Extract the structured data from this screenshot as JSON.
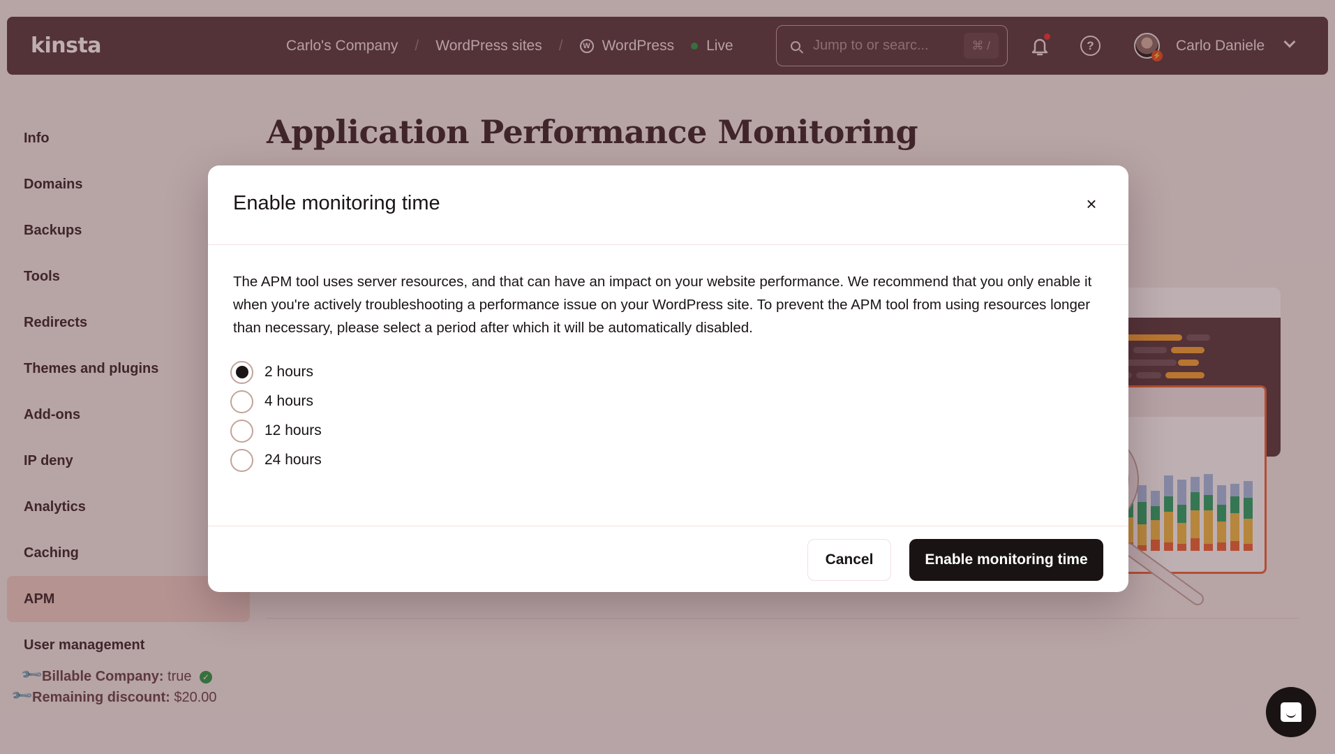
{
  "topbar": {
    "logo": "kinsta",
    "breadcrumbs": [
      "Carlo's Company",
      "WordPress sites",
      "WordPress"
    ],
    "separator": "/",
    "wp_icon": "W",
    "status": "Live",
    "status_color": "#2e9e4d",
    "search_placeholder": "Jump to or searc...",
    "search_shortcut": "⌘ /",
    "help_glyph": "?",
    "username": "Carlo Daniele",
    "avatar_badge": "⚡"
  },
  "sidebar": {
    "items": [
      {
        "label": "Info"
      },
      {
        "label": "Domains"
      },
      {
        "label": "Backups"
      },
      {
        "label": "Tools"
      },
      {
        "label": "Redirects"
      },
      {
        "label": "Themes and plugins"
      },
      {
        "label": "Add-ons"
      },
      {
        "label": "IP deny"
      },
      {
        "label": "Analytics"
      },
      {
        "label": "Caching"
      },
      {
        "label": "APM",
        "active": true
      },
      {
        "label": "User management"
      }
    ],
    "meta": [
      {
        "label": "Billable Company:",
        "value": "true",
        "verified": true
      },
      {
        "label": "Remaining discount:",
        "value": "$20.00"
      }
    ],
    "wrench_glyph": "🔧",
    "check_glyph": "✓"
  },
  "main": {
    "title": "Application Performance Monitoring"
  },
  "modal": {
    "title": "Enable monitoring time",
    "close_glyph": "×",
    "description": "The APM tool uses server resources, and that can have an impact on your website performance. We recommend that you only enable it when you're actively troubleshooting a performance issue on your WordPress site. To prevent the APM tool from using resources longer than necessary, please select a period after which it will be automatically disabled.",
    "options": [
      {
        "label": "2 hours",
        "selected": true
      },
      {
        "label": "4 hours",
        "selected": false
      },
      {
        "label": "12 hours",
        "selected": false
      },
      {
        "label": "24 hours",
        "selected": false
      }
    ],
    "cancel_label": "Cancel",
    "confirm_label": "Enable monitoring time"
  },
  "colors": {
    "topbar_bg": "#5b3f44",
    "primary_button": "#1a1314",
    "active_nav": "#f0d5cc",
    "accent_orange": "#ef6a3c"
  }
}
